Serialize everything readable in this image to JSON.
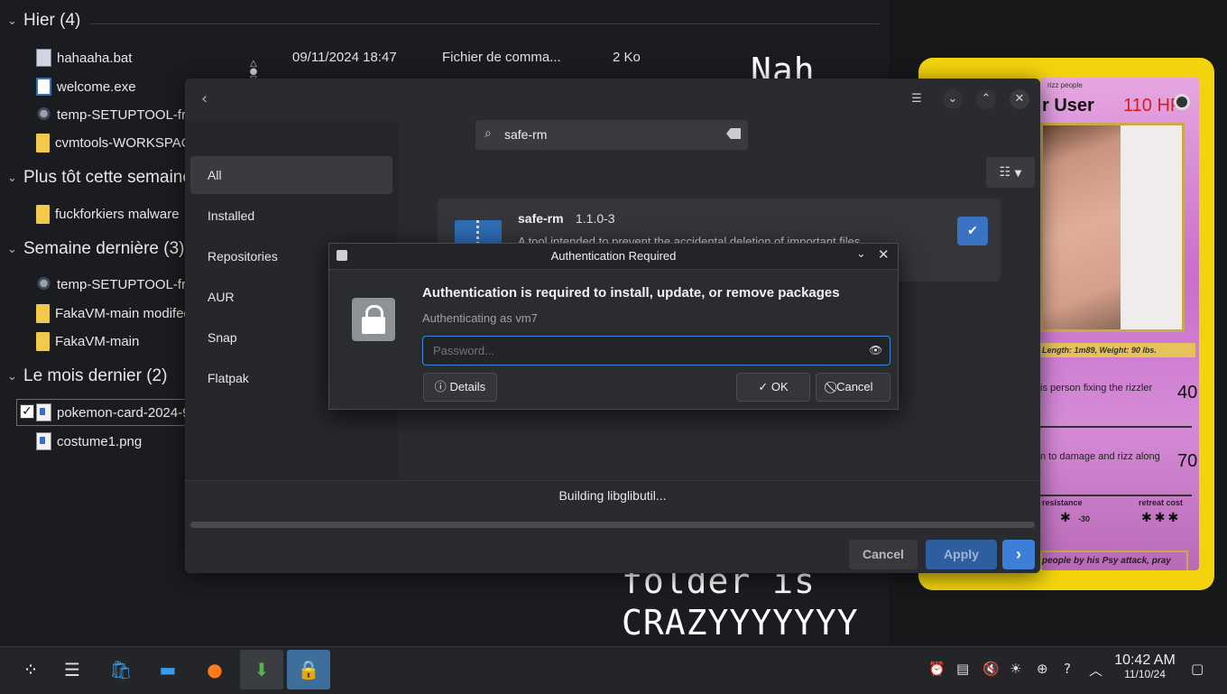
{
  "explorer": {
    "groups": [
      {
        "label": "Hier (4)"
      },
      {
        "label": "Plus tôt cette semaine ("
      },
      {
        "label": "Semaine dernière (3)"
      },
      {
        "label": "Le mois dernier (2)"
      }
    ],
    "files": [
      {
        "name": "hahaaha.bat",
        "date": "09/11/2024 18:47",
        "type": "Fichier de comma...",
        "size": "2 Ko"
      },
      {
        "name": "welcome.exe"
      },
      {
        "name": "temp-SETUPTOOL-from"
      },
      {
        "name": "cvmtools-WORKSPACE"
      },
      {
        "name": "fuckforkiers malware"
      },
      {
        "name": "temp-SETUPTOOL-from"
      },
      {
        "name": "FakaVM-main modifed"
      },
      {
        "name": "FakaVM-main"
      },
      {
        "name": "pokemon-card-2024-9-"
      },
      {
        "name": "costume1.png"
      }
    ],
    "overlay_text": {
      "top": "Nah",
      "line1": "folder is",
      "line2": "CRAZYYYYYYY"
    }
  },
  "card": {
    "top": "rizz people",
    "name": "r User",
    "hp": "110 HP",
    "info": "Length: 1m89, Weight: 90 lbs.",
    "attack1": "is person fixing the rizzler",
    "attack1_dmg": "40",
    "attack2": "n to damage and rizz along",
    "attack2_dmg": "70",
    "resistance": "resistance",
    "resistance_val": "-30",
    "retreat": "retreat cost",
    "desc": "people by his Psy attack, pray"
  },
  "discover": {
    "search": {
      "value": "safe-rm"
    },
    "sidebar": [
      {
        "label": "All"
      },
      {
        "label": "Installed"
      },
      {
        "label": "Repositories"
      },
      {
        "label": "AUR"
      },
      {
        "label": "Snap"
      },
      {
        "label": "Flatpak"
      }
    ],
    "app": {
      "name": "safe-rm",
      "version": "1.1.0-3",
      "description": "A tool intended to prevent the accidental deletion of important files"
    },
    "status": "Building libglibutil...",
    "progress": 0,
    "buttons": {
      "cancel": "Cancel",
      "apply": "Apply",
      "next": "›"
    }
  },
  "auth": {
    "title": "Authentication Required",
    "message": "Authentication is required to install, update, or remove packages",
    "user": "Authenticating as vm7",
    "password_placeholder": "Password...",
    "details": "Details",
    "ok": "OK",
    "cancel": "Cancel"
  },
  "taskbar": {
    "time": "10:42 AM",
    "date": "11/10/24"
  },
  "colors": {
    "accent": "#3d7fd6",
    "card_border": "#f3d40c",
    "hp": "#d21f1f"
  }
}
